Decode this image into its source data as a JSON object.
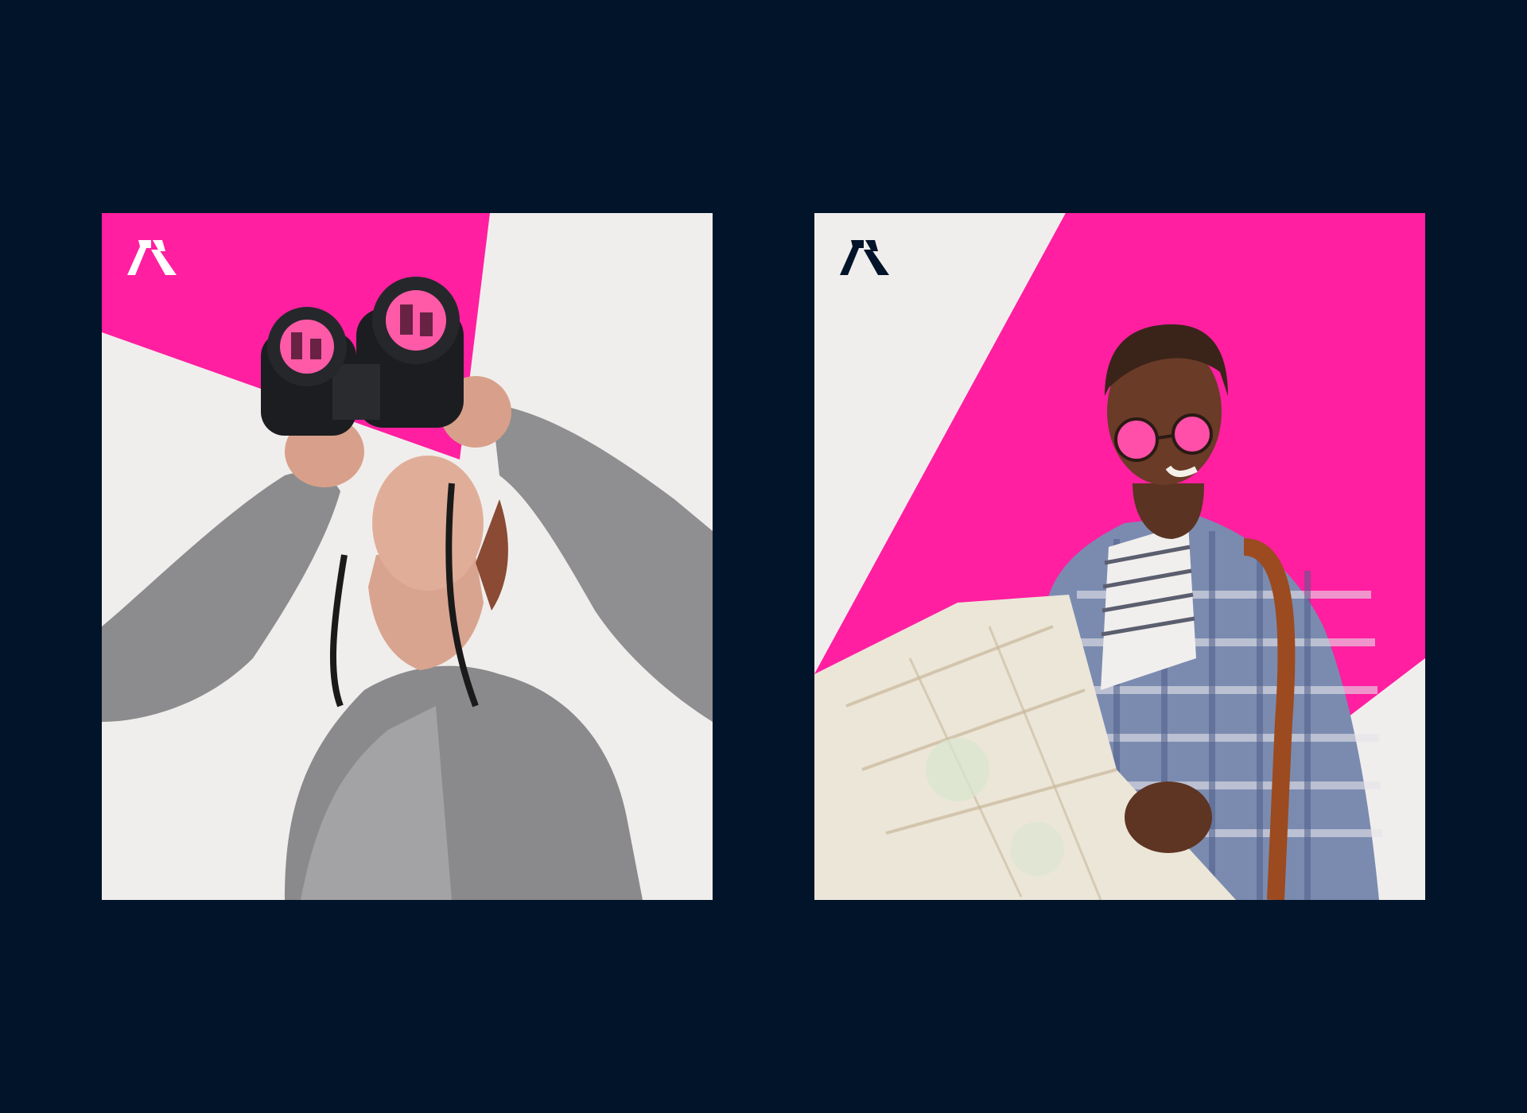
{
  "colors": {
    "background": "#02142a",
    "accent_pink": "#ff1fa0",
    "panel_light": "#f0eeed",
    "logo_left": "#ffffff",
    "logo_right": "#02142a"
  },
  "cards": [
    {
      "id": "binoculars-card",
      "logo_icon": "brand-mark-icon",
      "photo_subject": "person-with-binoculars-photo"
    },
    {
      "id": "map-card",
      "logo_icon": "brand-mark-icon",
      "photo_subject": "man-with-map-photo"
    }
  ]
}
